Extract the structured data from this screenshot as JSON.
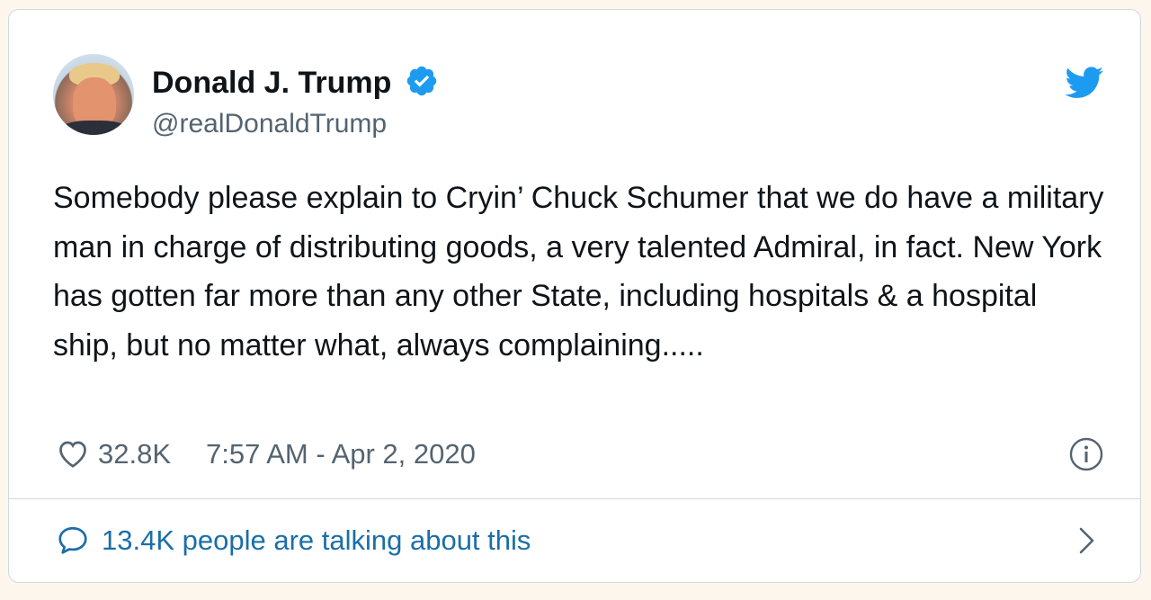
{
  "author": {
    "display_name": "Donald J. Trump",
    "handle": "@realDonaldTrump",
    "verified": true
  },
  "tweet": {
    "text": "Somebody please explain to Cryin’ Chuck Schumer that we do have a military man in charge of distributing goods, a very talented Admiral, in fact. New York has gotten far more than any other State, including hospitals & a hospital ship, but no matter what, always complaining....."
  },
  "meta": {
    "like_count": "32.8K",
    "timestamp": "7:57 AM - Apr 2, 2020"
  },
  "footer": {
    "talking_text": "13.4K people are talking about this"
  },
  "icons": {
    "brand": "bird-icon",
    "verified": "verified-badge-icon",
    "like": "heart-icon",
    "info": "info-icon",
    "comment": "comment-icon",
    "chevron": "chevron-right-icon"
  },
  "colors": {
    "brand_blue": "#1d9bf0",
    "link_blue": "#1b6ea8",
    "text": "#0f1419",
    "muted": "#536471",
    "border": "#cfd9de",
    "page_background": "#fdf6ec"
  }
}
